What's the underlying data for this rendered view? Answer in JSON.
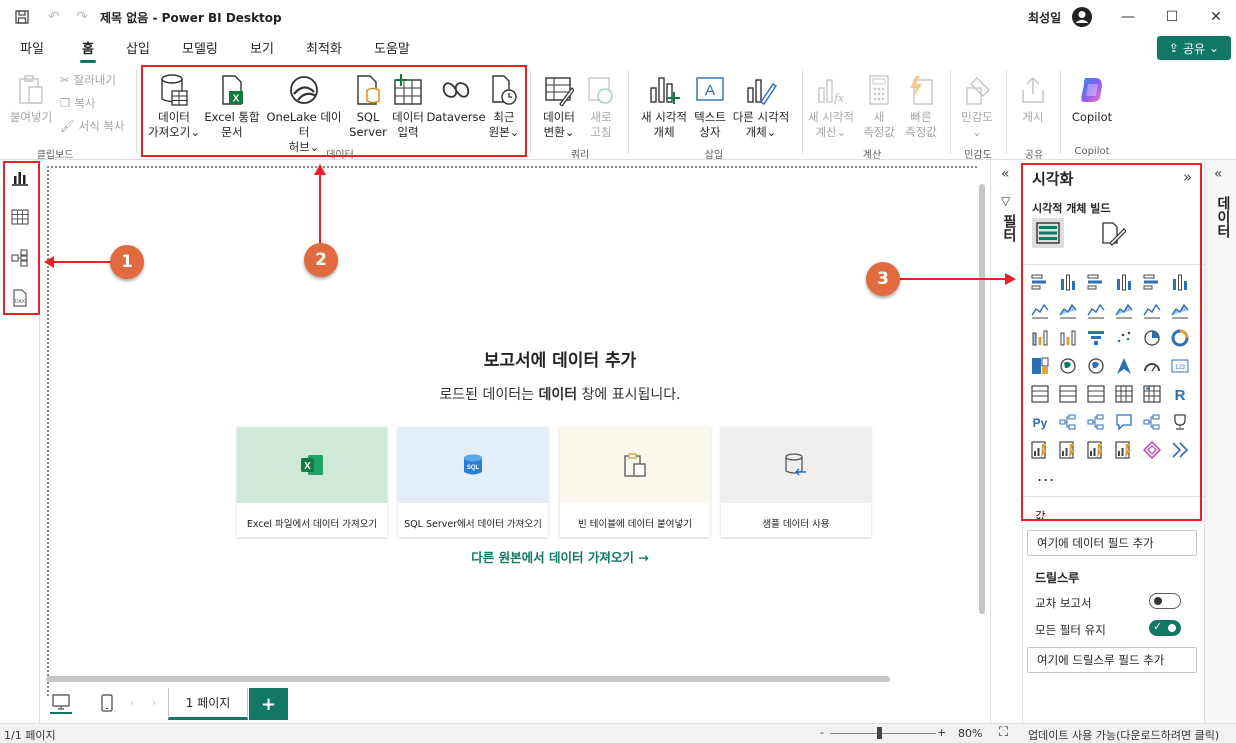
{
  "window": {
    "title": "제목 없음 - Power BI Desktop",
    "user_name": "최성일"
  },
  "ribbon_tabs": [
    {
      "label": "파일"
    },
    {
      "label": "홈"
    },
    {
      "label": "삽입"
    },
    {
      "label": "모델링"
    },
    {
      "label": "보기"
    },
    {
      "label": "최적화"
    },
    {
      "label": "도움말"
    }
  ],
  "share_label": "공유",
  "ribbon": {
    "clipboard": {
      "paste": "붙여넣기",
      "cut": "잘라내기",
      "copy": "복사",
      "format_painter": "서식 복사",
      "group": "클립보드"
    },
    "data": {
      "get_data_1": "데이터",
      "get_data_2": "가져오기",
      "excel_1": "Excel 통합",
      "excel_2": "문서",
      "onelake_1": "OneLake 데이터",
      "onelake_2": "허브",
      "sql_1": "SQL",
      "sql_2": "Server",
      "enter_1": "데이터",
      "enter_2": "입력",
      "dataverse": "Dataverse",
      "recent_1": "최근",
      "recent_2": "원본",
      "group": "데이터"
    },
    "queries": {
      "transform_1": "데이터",
      "transform_2": "변환",
      "refresh_1": "새로",
      "refresh_2": "고침",
      "group": "쿼리"
    },
    "insert": {
      "new_visual_1": "새 시각적",
      "new_visual_2": "개체",
      "textbox_1": "텍스트",
      "textbox_2": "상자",
      "more_visuals_1": "다른 시각적",
      "more_visuals_2": "개체",
      "group": "삽입"
    },
    "calc": {
      "new_visual_calc_1": "새 시각적",
      "new_visual_calc_2": "계산",
      "new_measure_1": "새",
      "new_measure_2": "측정값",
      "quick_measure_1": "빠른",
      "quick_measure_2": "측정값",
      "group": "계산"
    },
    "sensitivity": {
      "label": "민감도",
      "group": "민감도"
    },
    "share": {
      "publish": "게시",
      "group": "공유"
    },
    "copilot": {
      "label": "Copilot",
      "group": "Copilot"
    }
  },
  "canvas": {
    "title": "보고서에 데이터 추가",
    "subtitle_pre": "로드된 데이터는 ",
    "subtitle_bold": "데이터",
    "subtitle_post": " 창에 표시됩니다.",
    "cards": [
      {
        "label": "Excel 파일에서 데이터 가져오기",
        "color": "#cfe9d9"
      },
      {
        "label": "SQL Server에서 데이터 가져오기",
        "color": "#e3eef9"
      },
      {
        "label": "빈 테이블에 데이터 붙여넣기",
        "color": "#fbf9ee"
      },
      {
        "label": "샘플 데이터 사용",
        "color": "#f0efee"
      }
    ],
    "other_sources": "다른 원본에서 데이터 가져오기 →"
  },
  "page_tabs": [
    {
      "label": "1 페이지"
    }
  ],
  "status": {
    "page_count": "1/1 페이지",
    "zoom": "80%",
    "update": "업데이트 사용 가능(다운로드하려면 클릭)",
    "zoom_minus": "-",
    "zoom_plus": "+"
  },
  "panes": {
    "filter_label": "필터",
    "data_label": "데이터",
    "viz": {
      "title": "시각화",
      "build_label": "시각적 개체 빌드",
      "more": "...",
      "values_label": "값",
      "add_field": "여기에 데이터 필드 추가",
      "drillthrough": "드릴스루",
      "cross_report": "교차 보고서",
      "keep_filters": "모든 필터 유지",
      "add_drill_field": "여기에 드릴스루 필드 추가"
    }
  },
  "callouts": [
    "1",
    "2",
    "3"
  ],
  "colors": {
    "accent": "#117865",
    "annotation": "#e8202a",
    "badge": "#e26a3f"
  }
}
